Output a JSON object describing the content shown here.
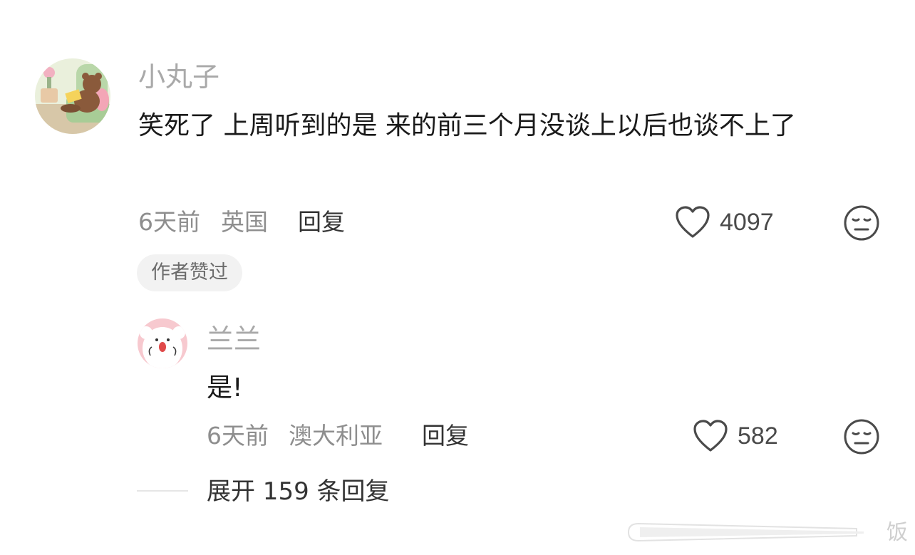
{
  "comment": {
    "username": "小丸子",
    "text": "笑死了 上周听到的是 来的前三个月没谈上以后也谈不上了",
    "time": "6天前",
    "location": "英国",
    "reply_label": "回复",
    "likes": "4097",
    "badge": "作者赞过"
  },
  "reply": {
    "username": "兰兰",
    "text": "是!",
    "time": "6天前",
    "location": "澳大利亚",
    "reply_label": "回复",
    "likes": "582"
  },
  "expand_label": "展开 159 条回复",
  "watermark": "饭"
}
